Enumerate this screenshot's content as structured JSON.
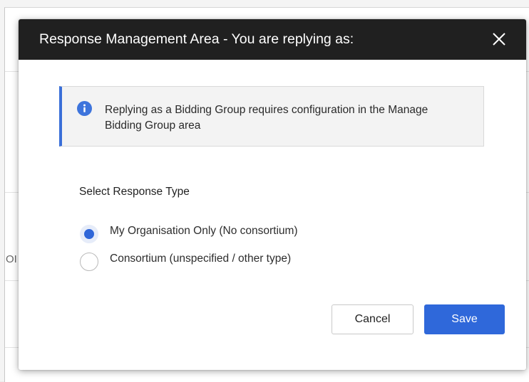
{
  "background": {
    "fragment_text": "OI"
  },
  "modal": {
    "title": "Response Management Area - You are replying as:",
    "close_icon": "close-icon",
    "info": {
      "icon": "info-icon",
      "message": "Replying as a Bidding Group requires configuration in the Manage Bidding Group area"
    },
    "response_type": {
      "label": "Select Response Type",
      "options": [
        {
          "label": "My Organisation Only (No consortium)",
          "selected": true
        },
        {
          "label": "Consortium (unspecified / other type)",
          "selected": false
        }
      ]
    },
    "buttons": {
      "cancel": "Cancel",
      "save": "Save"
    }
  },
  "colors": {
    "header_bg": "#202020",
    "accent": "#2f68da",
    "info_border": "#3a6fd8"
  }
}
